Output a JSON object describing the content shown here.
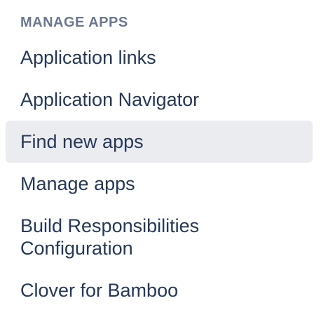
{
  "sidebar": {
    "heading": "MANAGE APPS",
    "selected_index": 2,
    "items": [
      {
        "label": "Application links"
      },
      {
        "label": "Application Navigator"
      },
      {
        "label": "Find new apps"
      },
      {
        "label": "Manage apps"
      },
      {
        "label": "Build Responsibilities Configuration"
      },
      {
        "label": "Clover for Bamboo"
      }
    ]
  },
  "colors": {
    "heading": "#6b778c",
    "item_text": "#253858",
    "selected_background": "#ebecf0",
    "background": "#ffffff"
  }
}
